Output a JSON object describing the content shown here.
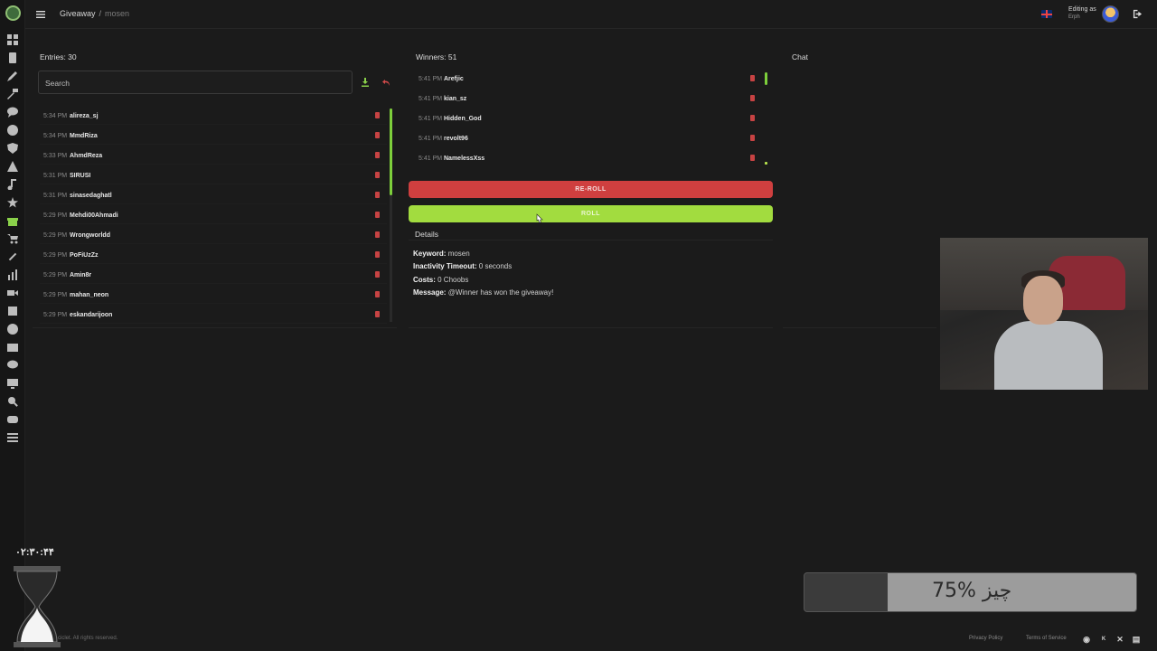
{
  "header": {
    "breadcrumb": [
      "Giveaway",
      "mosen"
    ],
    "separator": "/",
    "editing_label": "Editing as",
    "editing_user": "Erph"
  },
  "entries": {
    "title": "Entries: 30",
    "search_placeholder": "Search",
    "rows": [
      {
        "time": "5:34 PM",
        "name": "alireza_sj"
      },
      {
        "time": "5:34 PM",
        "name": "MmdRiza"
      },
      {
        "time": "5:33 PM",
        "name": "AhmdReza"
      },
      {
        "time": "5:31 PM",
        "name": "SIRUSI"
      },
      {
        "time": "5:31 PM",
        "name": "sinasedaghatl"
      },
      {
        "time": "5:29 PM",
        "name": "Mehdi00Ahmadi"
      },
      {
        "time": "5:29 PM",
        "name": "Wrongworldd"
      },
      {
        "time": "5:29 PM",
        "name": "PoFiUzZz"
      },
      {
        "time": "5:29 PM",
        "name": "Amin8r"
      },
      {
        "time": "5:29 PM",
        "name": "mahan_neon"
      },
      {
        "time": "5:29 PM",
        "name": "eskandarijoon"
      }
    ]
  },
  "winners": {
    "title": "Winners: 51",
    "rows": [
      {
        "time": "5:41 PM",
        "name": "Arefjic"
      },
      {
        "time": "5:41 PM",
        "name": "kian_sz"
      },
      {
        "time": "5:41 PM",
        "name": "Hidden_God"
      },
      {
        "time": "5:41 PM",
        "name": "revolt96"
      },
      {
        "time": "5:41 PM",
        "name": "NamelessXss"
      }
    ],
    "reroll_label": "RE-ROLL",
    "roll_label": "ROLL"
  },
  "details": {
    "title": "Details",
    "lines": [
      {
        "label": "Keyword:",
        "value": "mosen"
      },
      {
        "label": "Inactivity Timeout:",
        "value": "0 seconds"
      },
      {
        "label": "Costs:",
        "value": "0 Choobs"
      },
      {
        "label": "Message:",
        "value": "@Winner has won the giveaway!"
      }
    ]
  },
  "chat": {
    "title": "Chat"
  },
  "overlay": {
    "timer": "۰۲:۳۰:۴۴",
    "progress_text": "75% چیز",
    "progress_fraction": 0.75
  },
  "footer": {
    "copyright": "ciclet. All rights reserved.",
    "privacy": "Privacy Policy",
    "terms": "Terms of Service",
    "icons": [
      "discord-icon",
      "kick-icon",
      "x-icon",
      "document-icon"
    ]
  },
  "colors": {
    "accent_green": "#a2dc3f",
    "reroll_red": "#cf3f3f",
    "background": "#1b1b1b"
  }
}
